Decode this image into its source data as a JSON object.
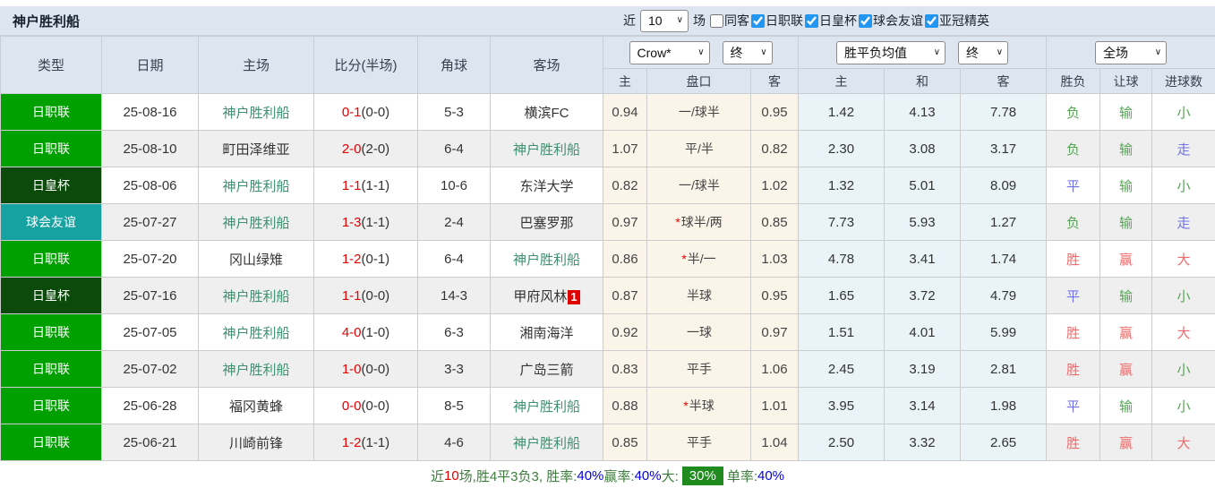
{
  "colors": {
    "accent_blue": "#2196f3",
    "header_bg": "#dce5f0",
    "team_green": "#3d9070",
    "score_red": "#e60000",
    "league": {
      "日职联": "#00a000",
      "日皇杯": "#0b4a0b",
      "球会友谊": "#17a2a2"
    },
    "result_palette": {
      "red": "#ef6a6a",
      "green": "#55a555",
      "blue": "#7272e8"
    },
    "footer_badge_green": "#1f8b1f"
  },
  "toolbar": {
    "team_title": "神户胜利船",
    "near_label": "近",
    "matches_value": "10",
    "games_label": "场",
    "same_opponent": {
      "label": "同客",
      "checked": false
    },
    "filters": [
      {
        "label": "日职联",
        "checked": true
      },
      {
        "label": "日皇杯",
        "checked": true
      },
      {
        "label": "球会友谊",
        "checked": true
      },
      {
        "label": "亚冠精英",
        "checked": true
      }
    ]
  },
  "table": {
    "static_headers": [
      "类型",
      "日期",
      "主场",
      "比分(半场)",
      "角球",
      "客场"
    ],
    "selects": {
      "odds_company": "Crow*",
      "odds_stage": "终",
      "avg_type": "胜平负均值",
      "avg_stage": "终",
      "scope": "全场"
    },
    "sub_headers": [
      "主",
      "盘口",
      "客",
      "主",
      "和",
      "客",
      "胜负",
      "让球",
      "进球数"
    ],
    "rows": [
      {
        "league": "日职联",
        "date": "25-08-16",
        "home": "神户胜利船",
        "home_team": true,
        "score": "0-1",
        "ht": "(0-0)",
        "corner": "5-3",
        "away": "横滨FC",
        "away_team": false,
        "away_badge": "",
        "odds_home": "0.94",
        "star": "",
        "handicap": "一/球半",
        "odds_away": "0.95",
        "avg_win": "1.42",
        "avg_draw": "4.13",
        "avg_lose": "7.78",
        "result": [
          "负",
          "green"
        ],
        "asian": [
          "输",
          "green"
        ],
        "goals": [
          "小",
          "green"
        ]
      },
      {
        "league": "日职联",
        "date": "25-08-10",
        "home": "町田泽维亚",
        "home_team": false,
        "score": "2-0",
        "ht": "(2-0)",
        "corner": "6-4",
        "away": "神户胜利船",
        "away_team": true,
        "away_badge": "",
        "odds_home": "1.07",
        "star": "",
        "handicap": "平/半",
        "odds_away": "0.82",
        "avg_win": "2.30",
        "avg_draw": "3.08",
        "avg_lose": "3.17",
        "result": [
          "负",
          "green"
        ],
        "asian": [
          "输",
          "green"
        ],
        "goals": [
          "走",
          "blue"
        ]
      },
      {
        "league": "日皇杯",
        "date": "25-08-06",
        "home": "神户胜利船",
        "home_team": true,
        "score": "1-1",
        "ht": "(1-1)",
        "corner": "10-6",
        "away": "东洋大学",
        "away_team": false,
        "away_badge": "",
        "odds_home": "0.82",
        "star": "",
        "handicap": "一/球半",
        "odds_away": "1.02",
        "avg_win": "1.32",
        "avg_draw": "5.01",
        "avg_lose": "8.09",
        "result": [
          "平",
          "blue"
        ],
        "asian": [
          "输",
          "green"
        ],
        "goals": [
          "小",
          "green"
        ]
      },
      {
        "league": "球会友谊",
        "date": "25-07-27",
        "home": "神户胜利船",
        "home_team": true,
        "score": "1-3",
        "ht": "(1-1)",
        "corner": "2-4",
        "away": "巴塞罗那",
        "away_team": false,
        "away_badge": "",
        "odds_home": "0.97",
        "star": "*",
        "handicap": "球半/两",
        "odds_away": "0.85",
        "avg_win": "7.73",
        "avg_draw": "5.93",
        "avg_lose": "1.27",
        "result": [
          "负",
          "green"
        ],
        "asian": [
          "输",
          "green"
        ],
        "goals": [
          "走",
          "blue"
        ]
      },
      {
        "league": "日职联",
        "date": "25-07-20",
        "home": "冈山绿雉",
        "home_team": false,
        "score": "1-2",
        "ht": "(0-1)",
        "corner": "6-4",
        "away": "神户胜利船",
        "away_team": true,
        "away_badge": "",
        "odds_home": "0.86",
        "star": "*",
        "handicap": "半/一",
        "odds_away": "1.03",
        "avg_win": "4.78",
        "avg_draw": "3.41",
        "avg_lose": "1.74",
        "result": [
          "胜",
          "red"
        ],
        "asian": [
          "赢",
          "red"
        ],
        "goals": [
          "大",
          "red"
        ]
      },
      {
        "league": "日皇杯",
        "date": "25-07-16",
        "home": "神户胜利船",
        "home_team": true,
        "score": "1-1",
        "ht": "(0-0)",
        "corner": "14-3",
        "away": "甲府风林",
        "away_team": false,
        "away_badge": "1",
        "odds_home": "0.87",
        "star": "",
        "handicap": "半球",
        "odds_away": "0.95",
        "avg_win": "1.65",
        "avg_draw": "3.72",
        "avg_lose": "4.79",
        "result": [
          "平",
          "blue"
        ],
        "asian": [
          "输",
          "green"
        ],
        "goals": [
          "小",
          "green"
        ]
      },
      {
        "league": "日职联",
        "date": "25-07-05",
        "home": "神户胜利船",
        "home_team": true,
        "score": "4-0",
        "ht": "(1-0)",
        "corner": "6-3",
        "away": "湘南海洋",
        "away_team": false,
        "away_badge": "",
        "odds_home": "0.92",
        "star": "",
        "handicap": "一球",
        "odds_away": "0.97",
        "avg_win": "1.51",
        "avg_draw": "4.01",
        "avg_lose": "5.99",
        "result": [
          "胜",
          "red"
        ],
        "asian": [
          "赢",
          "red"
        ],
        "goals": [
          "大",
          "red"
        ]
      },
      {
        "league": "日职联",
        "date": "25-07-02",
        "home": "神户胜利船",
        "home_team": true,
        "score": "1-0",
        "ht": "(0-0)",
        "corner": "3-3",
        "away": "广岛三箭",
        "away_team": false,
        "away_badge": "",
        "odds_home": "0.83",
        "star": "",
        "handicap": "平手",
        "odds_away": "1.06",
        "avg_win": "2.45",
        "avg_draw": "3.19",
        "avg_lose": "2.81",
        "result": [
          "胜",
          "red"
        ],
        "asian": [
          "赢",
          "red"
        ],
        "goals": [
          "小",
          "green"
        ]
      },
      {
        "league": "日职联",
        "date": "25-06-28",
        "home": "福冈黄蜂",
        "home_team": false,
        "score": "0-0",
        "ht": "(0-0)",
        "corner": "8-5",
        "away": "神户胜利船",
        "away_team": true,
        "away_badge": "",
        "odds_home": "0.88",
        "star": "*",
        "handicap": "半球",
        "odds_away": "1.01",
        "avg_win": "3.95",
        "avg_draw": "3.14",
        "avg_lose": "1.98",
        "result": [
          "平",
          "blue"
        ],
        "asian": [
          "输",
          "green"
        ],
        "goals": [
          "小",
          "green"
        ]
      },
      {
        "league": "日职联",
        "date": "25-06-21",
        "home": "川崎前锋",
        "home_team": false,
        "score": "1-2",
        "ht": "(1-1)",
        "corner": "4-6",
        "away": "神户胜利船",
        "away_team": true,
        "away_badge": "",
        "odds_home": "0.85",
        "star": "",
        "handicap": "平手",
        "odds_away": "1.04",
        "avg_win": "2.50",
        "avg_draw": "3.32",
        "avg_lose": "2.65",
        "result": [
          "胜",
          "red"
        ],
        "asian": [
          "赢",
          "red"
        ],
        "goals": [
          "大",
          "red"
        ]
      }
    ]
  },
  "footer": {
    "segments": [
      {
        "text": "近",
        "style": "green"
      },
      {
        "text": "10",
        "style": "red"
      },
      {
        "text": "场,胜4平3负3, 胜率:",
        "style": "green"
      },
      {
        "text": "40%",
        "style": "blue"
      },
      {
        "text": " 赢率:",
        "style": "green"
      },
      {
        "text": "40%",
        "style": "blue"
      },
      {
        "text": " 大:",
        "style": "green"
      },
      {
        "text": "30%",
        "style": "badge"
      },
      {
        "text": " 单率:",
        "style": "green"
      },
      {
        "text": "40%",
        "style": "blue"
      }
    ]
  }
}
